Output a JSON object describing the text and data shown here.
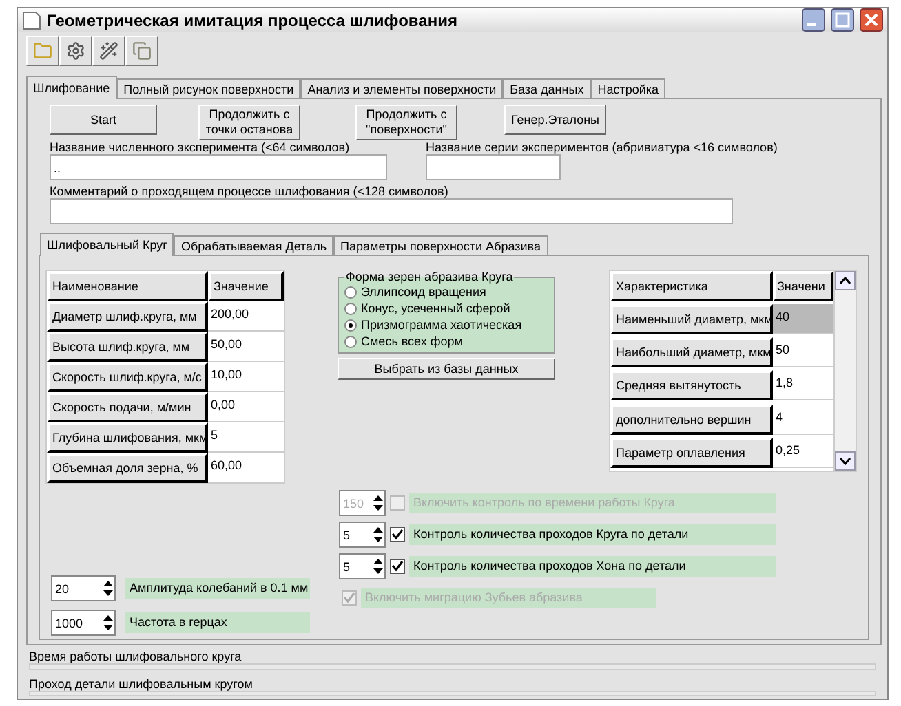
{
  "window": {
    "title": "Геометрическая имитация процесса шлифования"
  },
  "toolbar": [
    {
      "kind": "folder"
    },
    {
      "kind": "gear"
    },
    {
      "kind": "wand"
    },
    {
      "kind": "copy"
    }
  ],
  "tabs": [
    {
      "label": "Шлифование",
      "selected": true
    },
    {
      "label": "Полный рисунок поверхности",
      "selected": false
    },
    {
      "label": "Анализ и элементы поверхности",
      "selected": false
    },
    {
      "label": "База данных",
      "selected": false
    },
    {
      "label": "Настройка",
      "selected": false
    }
  ],
  "actions": [
    "Start",
    "Продолжить с\nточки останова",
    "Продолжить с\n\"поверхности\"",
    "Генер.Эталоны"
  ],
  "experiment_name": {
    "label": "Название численного эксперимента (<64 символов)",
    "value": ".."
  },
  "series_name": {
    "label": "Название серии экспериментов (абривиатура <16 символов)"
  },
  "comment": {
    "label": "Комментарий о проходящем процессе шлифования (<128 символов)"
  },
  "sub_tabs": [
    {
      "label": "Шлифовальный Круг",
      "selected": true
    },
    {
      "label": "Обрабатываемая Деталь",
      "selected": false
    },
    {
      "label": "Параметры поверхности Абразива",
      "selected": false
    }
  ],
  "wheel_table": {
    "columns": [
      "Наименование",
      "Значение"
    ],
    "rows": [
      {
        "name": "Диаметр шлиф.круга, мм",
        "value": "200,00"
      },
      {
        "name": "Высота шлиф.круга, мм",
        "value": "50,00"
      },
      {
        "name": "Скорость шлиф.круга, м/с",
        "value": "10,00"
      },
      {
        "name": "Скорость подачи, м/мин",
        "value": "0,00"
      },
      {
        "name": "Глубина шлифования, мкм",
        "value": "5"
      },
      {
        "name": "Объемная доля зерна, %",
        "value": "60,00"
      }
    ]
  },
  "grain_shape": {
    "title": "Форма зерен абразива  Круга",
    "options": [
      {
        "label": "Эллипсоид вращения",
        "selected": false
      },
      {
        "label": "Конус, усеченный сферой",
        "selected": false
      },
      {
        "label": "Призмограмма хаотическая",
        "selected": true
      },
      {
        "label": "Смесь всех форм",
        "selected": false
      }
    ],
    "button": "Выбрать из базы данных"
  },
  "grain_table": {
    "columns": [
      "Характеристика",
      "Значени"
    ],
    "rows": [
      {
        "name": "Наименьший  диаметр, мкм",
        "value": "40",
        "selected": true
      },
      {
        "name": "Наибольший диаметр, мкм",
        "value": "50",
        "selected": false
      },
      {
        "name": "Средняя вытянутость",
        "value": "1,8",
        "selected": false
      },
      {
        "name": "дополнительно вершин",
        "value": "4",
        "selected": false
      },
      {
        "name": "Параметр оплавления",
        "value": "0,25",
        "selected": false
      }
    ]
  },
  "controls": [
    {
      "kind": "spin_check",
      "value": "150",
      "label": "Включить контроль по времени работы Круга",
      "checked": false,
      "disabled": true
    },
    {
      "kind": "spin_check",
      "value": "5",
      "label": "Контроль количества проходов Круга по детали",
      "checked": true,
      "disabled": false
    },
    {
      "kind": "spin_check",
      "value": "5",
      "label": "Контроль количества проходов Хона по детали",
      "checked": true,
      "disabled": false
    },
    {
      "kind": "check",
      "label": "Включить миграцию Зубьев абразива",
      "checked": true,
      "disabled": true
    }
  ],
  "oscillation": [
    {
      "value": "20",
      "label": "Амплитуда колебаний в 0.1 мм"
    },
    {
      "value": "1000",
      "label": "Частота в герцах"
    }
  ],
  "progress": [
    {
      "label": "Время работы шлифовального круга"
    },
    {
      "label": "Проход детали шлифовальным кругом"
    }
  ]
}
